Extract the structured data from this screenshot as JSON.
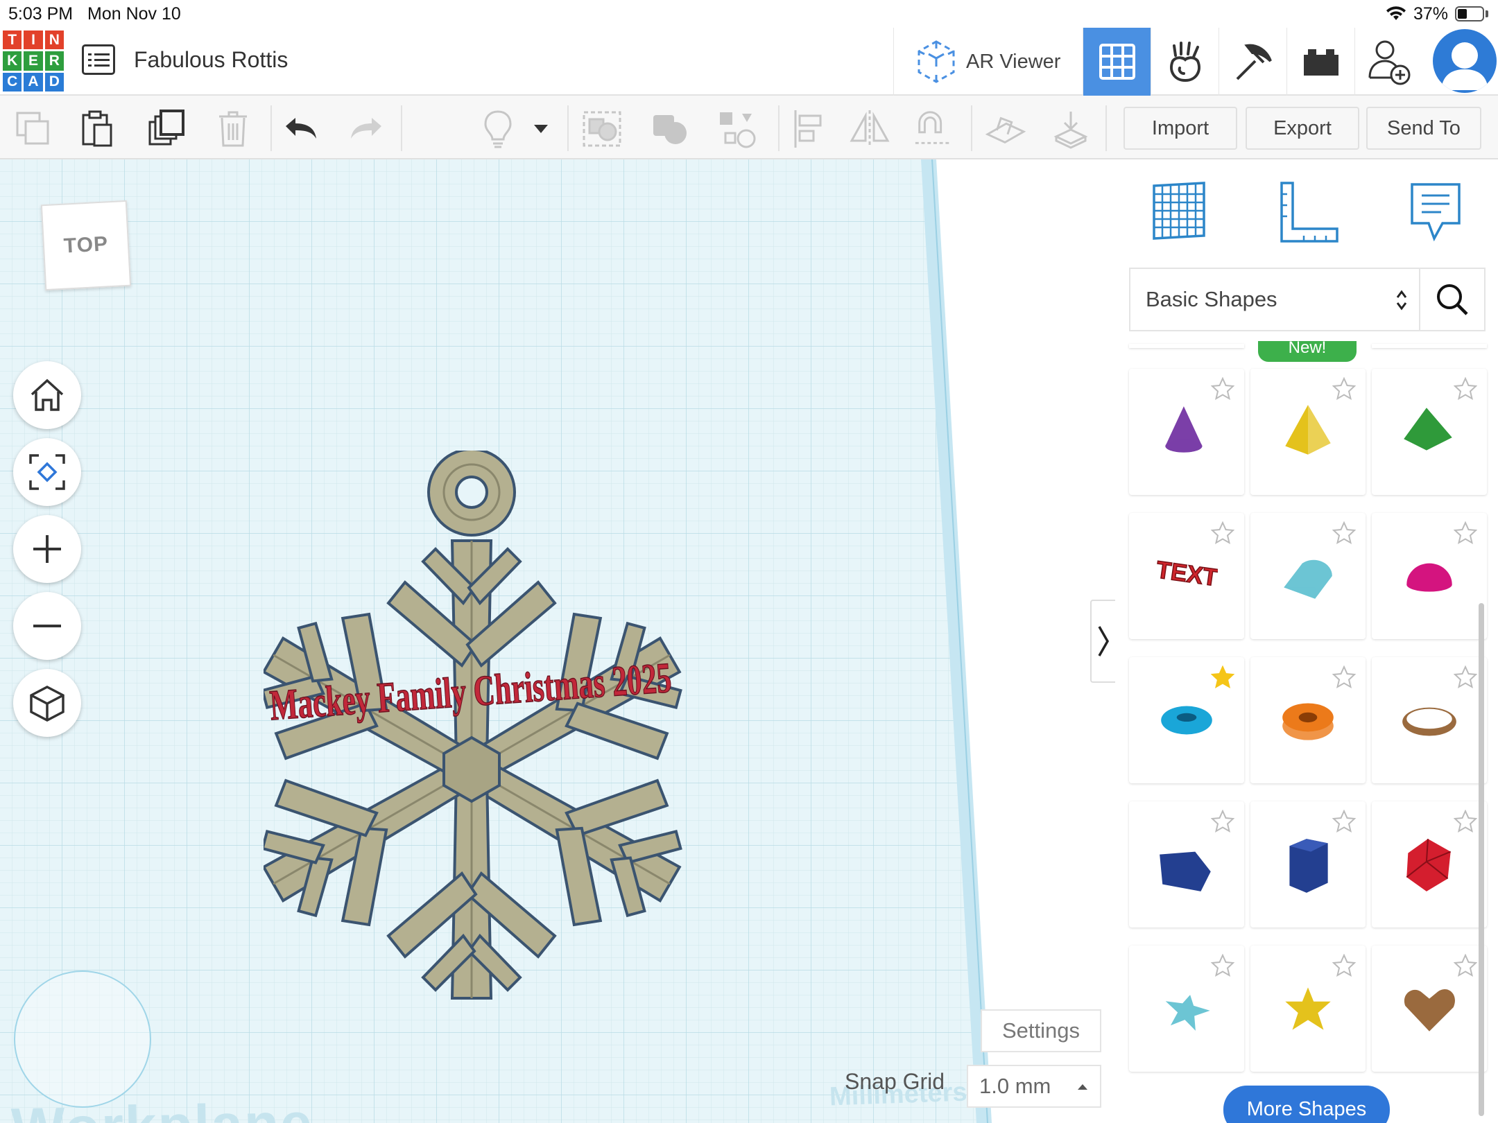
{
  "status_bar": {
    "time": "5:03 PM",
    "date": "Mon Nov 10",
    "battery": "37%",
    "battery_level": 0.37
  },
  "header": {
    "logo_letters": [
      "T",
      "I",
      "N",
      "K",
      "E",
      "R",
      "C",
      "A",
      "D"
    ],
    "logo_colors": [
      "#e2412a",
      "#e2412a",
      "#e2412a",
      "#2e9e3e",
      "#2e9e3e",
      "#2e9e3e",
      "#2a7cd6",
      "#2a7cd6",
      "#2a7cd6"
    ],
    "project_title": "Fabulous Rottis",
    "ar_viewer_label": "AR Viewer",
    "accent_color": "#4a90e2"
  },
  "toolbar": {
    "import_label": "Import",
    "export_label": "Export",
    "send_to_label": "Send To"
  },
  "workplane": {
    "view_cube_label": "TOP",
    "design_text": "Mackey Family Christmas 2025",
    "settings_label": "Settings",
    "snap_grid_label": "Snap Grid",
    "snap_grid_value": "1.0 mm",
    "units_label": "Millimeters",
    "workplane_label": "Workplane"
  },
  "panel": {
    "library_selected": "Basic Shapes",
    "new_badge": "New!",
    "more_shapes_label": "More Shapes",
    "shapes": [
      {
        "name": "cone",
        "color": "#7b3fa8",
        "favorite": false
      },
      {
        "name": "pyramid",
        "color": "#e4c21c",
        "favorite": false
      },
      {
        "name": "roof",
        "color": "#2f9a3a",
        "favorite": false
      },
      {
        "name": "text",
        "color": "#d0262c",
        "favorite": false
      },
      {
        "name": "half-cylinder",
        "color": "#6cc5d4",
        "favorite": false
      },
      {
        "name": "half-sphere",
        "color": "#d4147f",
        "favorite": false
      },
      {
        "name": "torus",
        "color": "#1aa6d8",
        "favorite": true
      },
      {
        "name": "tube",
        "color": "#ec7a1a",
        "favorite": false
      },
      {
        "name": "ring",
        "color": "#9a6a3e",
        "favorite": false
      },
      {
        "name": "polygon",
        "color": "#233f90",
        "favorite": false
      },
      {
        "name": "hexagonal-prism",
        "color": "#233f90",
        "favorite": false
      },
      {
        "name": "icosahedron",
        "color": "#d41e2e",
        "favorite": false
      },
      {
        "name": "star",
        "color": "#6cc5d4",
        "favorite": false
      },
      {
        "name": "star-yellow",
        "color": "#e4c21c",
        "favorite": false
      },
      {
        "name": "heart",
        "color": "#9a6a3e",
        "favorite": false
      }
    ]
  }
}
